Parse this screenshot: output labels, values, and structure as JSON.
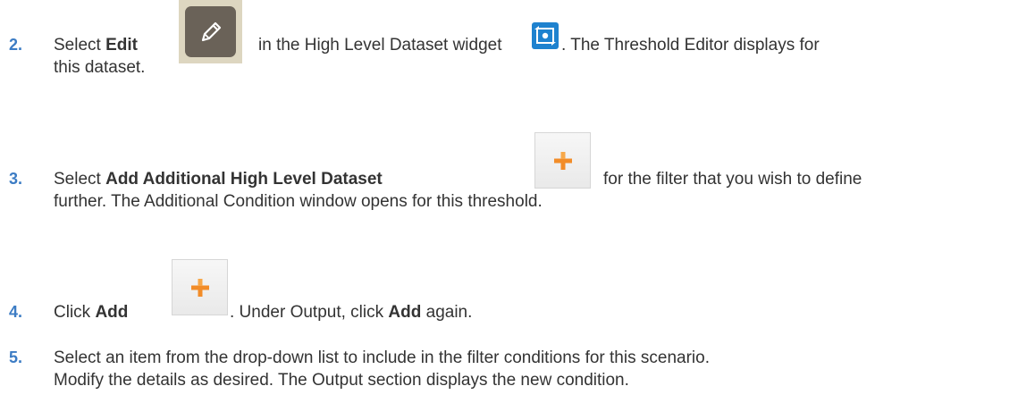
{
  "steps": [
    {
      "number": "2.",
      "select": "Select ",
      "edit_label": "Edit",
      "text_after_edit": "in the High Level Dataset widget",
      "text_after_widget": ". The Threshold Editor displays for",
      "line2": "this dataset."
    },
    {
      "number": "3.",
      "select": "Select ",
      "bold": "Add Additional High Level Dataset",
      "text_after_button": "for the filter that you wish to define",
      "line2": "further. The Additional Condition window opens for this threshold."
    },
    {
      "number": "4.",
      "click": "Click ",
      "bold": "Add",
      "text_after_button": ". Under Output, click ",
      "bold2": "Add",
      "text_end": " again."
    },
    {
      "number": "5.",
      "line1": "Select an item from the drop-down list to include in the filter conditions for this scenario.",
      "line2": "Modify the details as desired. The Output section displays the new condition."
    }
  ],
  "icons": {
    "edit": "pencil-icon",
    "widget": "dataset-swap-icon",
    "add": "plus-icon"
  },
  "colors": {
    "step_number": "#3c7cc4",
    "text": "#333333",
    "plus": "#f28c28"
  }
}
